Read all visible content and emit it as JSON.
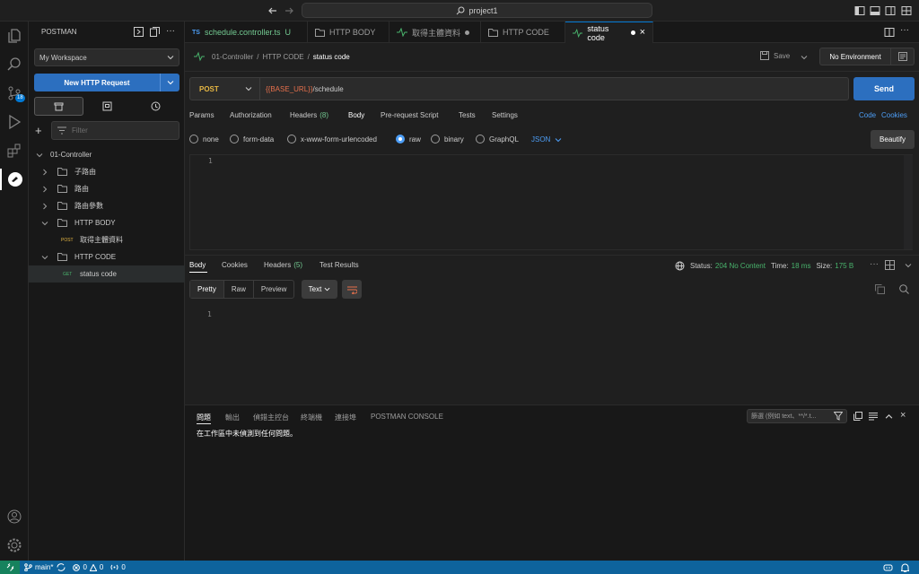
{
  "titlebar": {
    "search_text": "project1"
  },
  "activity": {
    "badge": "18"
  },
  "sidebar": {
    "title": "POSTMAN",
    "workspace": "My Workspace",
    "new_request": "New HTTP Request",
    "filter_placeholder": "Filter",
    "root": "01-Controller",
    "items": [
      {
        "label": "子路由",
        "type": "folder"
      },
      {
        "label": "路由",
        "type": "folder"
      },
      {
        "label": "路由參數",
        "type": "folder"
      },
      {
        "label": "HTTP BODY",
        "type": "folder-open"
      },
      {
        "label": "取得主體資料",
        "type": "request",
        "method": "POST"
      },
      {
        "label": "HTTP CODE",
        "type": "folder-open"
      },
      {
        "label": "status code",
        "type": "request",
        "method": "GET"
      }
    ]
  },
  "tabs": [
    {
      "label": "schedule.controller.ts",
      "prefix": "TS",
      "suffix": "U"
    },
    {
      "label": "HTTP BODY"
    },
    {
      "label": "取得主體資料"
    },
    {
      "label": "HTTP CODE"
    },
    {
      "label": "status code"
    }
  ],
  "request": {
    "breadcrumb_root": "01-Controller",
    "breadcrumb_folder": "HTTP CODE",
    "breadcrumb_current": "status code",
    "save_label": "Save",
    "environment": "No Environment",
    "method": "POST",
    "url_var": "{{BASE_URL}}",
    "url_path": "/schedule",
    "send_label": "Send",
    "tabs": [
      "Params",
      "Authorization",
      "Headers",
      "Body",
      "Pre-request Script",
      "Tests",
      "Settings"
    ],
    "headers_count": "(8)",
    "code_link": "Code",
    "cookies_link": "Cookies",
    "body_types": [
      "none",
      "form-data",
      "x-www-form-urlencoded",
      "raw",
      "binary",
      "GraphQL"
    ],
    "raw_format": "JSON",
    "beautify": "Beautify",
    "line_number": "1"
  },
  "response": {
    "tabs": [
      "Body",
      "Cookies",
      "Headers",
      "Test Results"
    ],
    "headers_count": "(5)",
    "status_label": "Status:",
    "status_value": "204 No Content",
    "time_label": "Time:",
    "time_value": "18 ms",
    "size_label": "Size:",
    "size_value": "175 B",
    "views": [
      "Pretty",
      "Raw",
      "Preview"
    ],
    "format": "Text",
    "line_number": "1"
  },
  "panel": {
    "tabs": [
      "問題",
      "輸出",
      "偵錯主控台",
      "終端機",
      "連接埠",
      "POSTMAN CONSOLE"
    ],
    "filter_placeholder": "篩選 (例如 text、**/*.t...",
    "message": "在工作區中未偵測到任何問題。"
  },
  "statusbar": {
    "branch": "main*",
    "errors": "0",
    "warnings": "0",
    "ports": "0"
  }
}
